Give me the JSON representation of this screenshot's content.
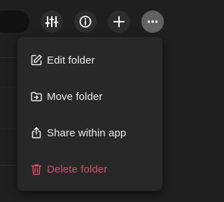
{
  "toolbar": {
    "buttons": [
      {
        "name": "filter-settings",
        "icon": "sliders-icon"
      },
      {
        "name": "info",
        "icon": "info-icon"
      },
      {
        "name": "add",
        "icon": "plus-icon"
      },
      {
        "name": "more",
        "icon": "more-horizontal-icon",
        "active": true
      }
    ]
  },
  "menu": {
    "items": [
      {
        "label": "Edit folder",
        "icon": "edit-icon"
      },
      {
        "label": "Move folder",
        "icon": "move-folder-icon"
      },
      {
        "label": "Share within app",
        "icon": "share-icon"
      },
      {
        "label": "Delete folder",
        "icon": "trash-icon",
        "danger": true
      }
    ]
  },
  "colors": {
    "background": "#1f1f1f",
    "menu_background": "#282828",
    "button_background": "#2d2d2d",
    "button_active_background": "#626262",
    "text": "#ededed",
    "danger": "#d5506b"
  }
}
